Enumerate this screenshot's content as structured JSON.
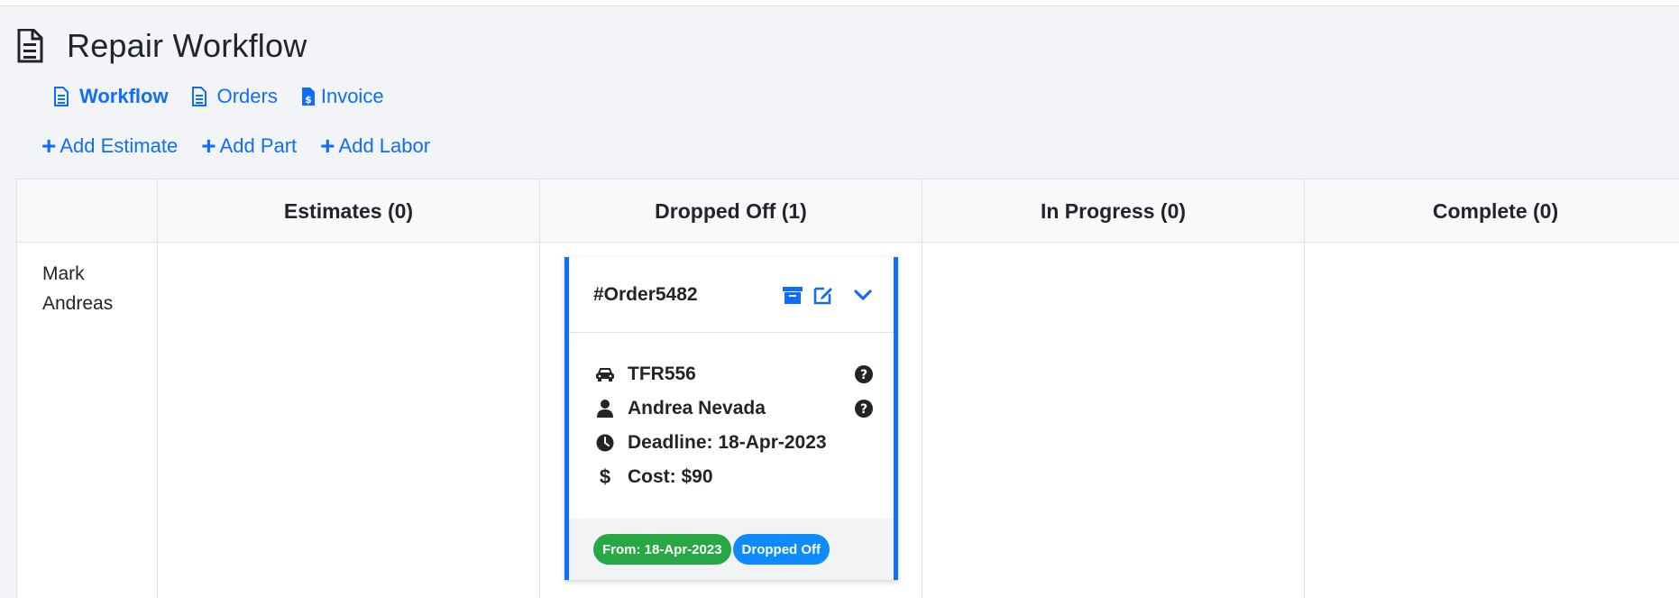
{
  "page": {
    "title": "Repair Workflow",
    "icon": "document-icon"
  },
  "tabs": [
    {
      "label": "Workflow",
      "icon": "document-icon",
      "active": true
    },
    {
      "label": "Orders",
      "icon": "file-list-icon",
      "active": false
    },
    {
      "label": "Invoice",
      "icon": "invoice-dollar-icon",
      "active": false
    }
  ],
  "actions": [
    {
      "label": "Add Estimate",
      "icon": "plus-icon"
    },
    {
      "label": "Add Part",
      "icon": "plus-icon"
    },
    {
      "label": "Add Labor",
      "icon": "plus-icon"
    }
  ],
  "board": {
    "columns": [
      "Estimates (0)",
      "Dropped Off (1)",
      "In Progress (0)",
      "Complete (0)"
    ],
    "rows": [
      {
        "label": "Mark Andreas",
        "cards": [
          {
            "column": "Dropped Off (1)",
            "title": "#Order5482",
            "header_icons": [
              "archive-icon",
              "edit-icon",
              "chevron-down-icon"
            ],
            "vehicle": "TFR556",
            "customer": "Andrea Nevada",
            "deadline": "Deadline: 18-Apr-2023",
            "cost": "Cost: $90",
            "badges": [
              {
                "label": "From: 18-Apr-2023",
                "color": "#28a745"
              },
              {
                "label": "Dropped Off",
                "color": "#0d8bff"
              }
            ]
          }
        ]
      }
    ]
  },
  "colors": {
    "accent": "#0d6efd",
    "background": "#f3f4f7",
    "text": "#212529"
  }
}
